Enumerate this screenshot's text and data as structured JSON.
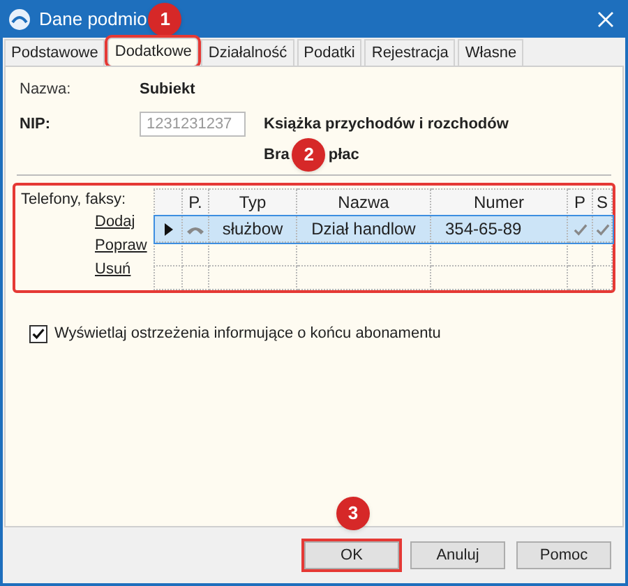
{
  "window": {
    "title": "Dane podmio"
  },
  "tabs": [
    {
      "label": "Podstawowe",
      "selected": false,
      "highlighted": false
    },
    {
      "label": "Dodatkowe",
      "selected": true,
      "highlighted": true
    },
    {
      "label": "Działalność",
      "selected": false,
      "highlighted": false
    },
    {
      "label": "Podatki",
      "selected": false,
      "highlighted": false
    },
    {
      "label": "Rejestracja",
      "selected": false,
      "highlighted": false
    },
    {
      "label": "Własne",
      "selected": false,
      "highlighted": false
    }
  ],
  "details": {
    "name_label": "Nazwa:",
    "name_value": "Subiekt",
    "nip_label": "NIP:",
    "nip_value": "1231231237",
    "ledger": "Książka przychodów i rozchodów",
    "payroll_start": "Bra",
    "payroll_end": "płac"
  },
  "phones": {
    "label": "Telefony, faksy:",
    "highlighted": true,
    "links": [
      "Dodaj",
      "Popraw",
      "Usuń"
    ],
    "columns": [
      "P.",
      "Typ",
      "Nazwa",
      "Numer",
      "P",
      "S"
    ],
    "rows": [
      {
        "selected": true,
        "current": true,
        "phone": true,
        "typ": "służbow",
        "nazwa": "Dział handlow",
        "numer": "354-65-89",
        "p": true,
        "s": true
      }
    ]
  },
  "warning_checkbox": {
    "label": "Wyświetlaj ostrzeżenia informujące o końcu abonamentu",
    "checked": true
  },
  "buttons": [
    {
      "label": "OK",
      "highlighted": true
    },
    {
      "label": "Anuluj",
      "highlighted": false
    },
    {
      "label": "Pomoc",
      "highlighted": false
    }
  ],
  "annotations": [
    "1",
    "2",
    "3"
  ]
}
